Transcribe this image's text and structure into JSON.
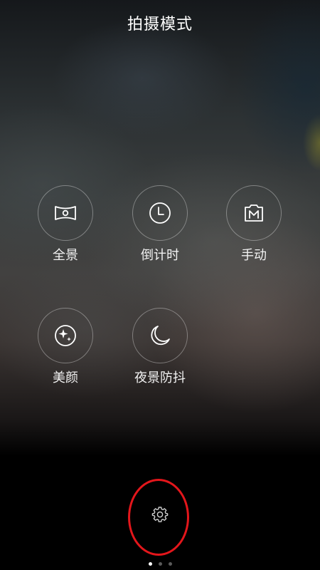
{
  "header": {
    "title": "拍摄模式"
  },
  "modes": [
    {
      "label": "全景",
      "icon": "panorama-icon"
    },
    {
      "label": "倒计时",
      "icon": "timer-icon"
    },
    {
      "label": "手动",
      "icon": "manual-icon"
    },
    {
      "label": "美颜",
      "icon": "beauty-icon"
    },
    {
      "label": "夜景防抖",
      "icon": "night-mode-icon"
    }
  ],
  "footer": {
    "settings_icon": "gear-icon",
    "page_indicator": {
      "total": 3,
      "active": 1
    }
  },
  "colors": {
    "annotation_oval": "#e3161b",
    "icon_stroke": "#ffffff"
  }
}
